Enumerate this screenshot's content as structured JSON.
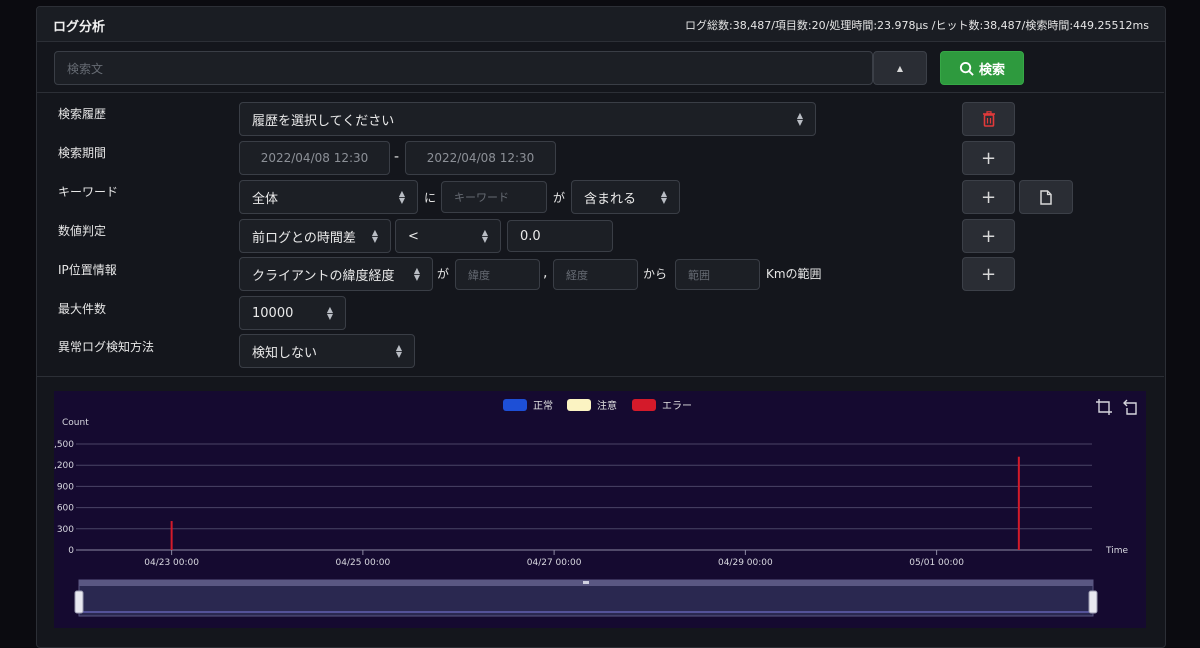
{
  "header": {
    "title": "ログ分析",
    "stats": "ログ総数:38,487/項目数:20/処理時間:23.978µs /ヒット数:38,487/検索時間:449.25512ms"
  },
  "search": {
    "placeholder": "検索文",
    "button_label": "検索",
    "toggle_icon": "▲"
  },
  "form": {
    "history_label": "検索履歴",
    "history_value": "履歴を選択してください",
    "period_label": "検索期間",
    "period_start": "2022/04/08 12:30",
    "period_sep": "-",
    "period_end": "2022/04/08 12:30",
    "keyword_label": "キーワード",
    "keyword_field": "全体",
    "keyword_ni": "に",
    "keyword_placeholder": "キーワード",
    "keyword_ga": "が",
    "keyword_cond": "含まれる",
    "numeric_label": "数値判定",
    "numeric_field": "前ログとの時間差",
    "numeric_op": "<",
    "numeric_value": "0.0",
    "ip_label": "IP位置情報",
    "ip_field": "クライアントの緯度経度",
    "ip_ga": "が",
    "ip_lat_placeholder": "緯度",
    "ip_comma": ",",
    "ip_lon_placeholder": "経度",
    "ip_kara": "から",
    "ip_range_placeholder": "範囲",
    "ip_unit": "Kmの範囲",
    "max_label": "最大件数",
    "max_value": "10000",
    "anomaly_label": "異常ログ検知方法",
    "anomaly_value": "検知しない",
    "plus": "+"
  },
  "chart_data": {
    "type": "bar",
    "legend": [
      {
        "name": "正常",
        "color": "#1d4fd6"
      },
      {
        "name": "注意",
        "color": "#fbf3c2"
      },
      {
        "name": "エラー",
        "color": "#d41a2a"
      }
    ],
    "ylabel": "Count",
    "xlabel": "Time",
    "ylim": [
      0,
      1500
    ],
    "yticks": [
      0,
      300,
      600,
      900,
      1200,
      1500
    ],
    "ytick_labels": [
      "0",
      "300",
      "600",
      "900",
      ",200",
      ",500"
    ],
    "xlim": [
      "2022-04-22 00:00",
      "2022-05-02 15:00"
    ],
    "xticks": [
      "04/23 00:00",
      "04/25 00:00",
      "04/27 00:00",
      "04/29 00:00",
      "05/01 00:00"
    ],
    "xtick_values": [
      1,
      3,
      5,
      7,
      9
    ],
    "series": [
      {
        "name": "エラー",
        "x": [
          1.0,
          9.86
        ],
        "values": [
          410,
          1320
        ]
      }
    ],
    "grid": true,
    "legend_position": "top"
  },
  "icons": {
    "search": "search-icon",
    "trash": "trash-icon",
    "file": "file-icon",
    "zoom": "zoom-icon",
    "zoom_reset": "zoom-reset-icon",
    "toggle": "caret-up-icon"
  }
}
